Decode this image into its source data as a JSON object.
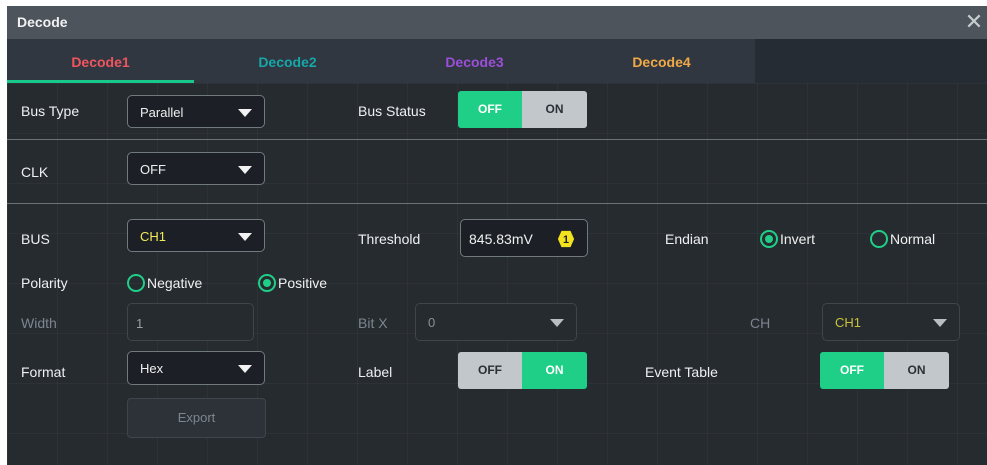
{
  "window": {
    "title": "Decode",
    "close_symbol": "✕"
  },
  "tabs": [
    {
      "label": "Decode1",
      "color": "#f0555f",
      "active": true
    },
    {
      "label": "Decode2",
      "color": "#16a7a9",
      "active": false
    },
    {
      "label": "Decode3",
      "color": "#9b4fd8",
      "active": false
    },
    {
      "label": "Decode4",
      "color": "#f0a946",
      "active": false
    }
  ],
  "bus_type": {
    "label": "Bus Type",
    "value": "Parallel"
  },
  "bus_status": {
    "label": "Bus Status",
    "off_label": "OFF",
    "on_label": "ON",
    "state": "OFF"
  },
  "clk": {
    "label": "CLK",
    "value": "OFF"
  },
  "bus": {
    "label": "BUS",
    "value": "CH1",
    "value_color": "#f2ea57"
  },
  "threshold": {
    "label": "Threshold",
    "value": "845.83mV",
    "badge": "1",
    "badge_color": "#f2e21d"
  },
  "endian": {
    "label": "Endian",
    "options": [
      "Invert",
      "Normal"
    ],
    "selected": "Invert"
  },
  "polarity": {
    "label": "Polarity",
    "options": [
      "Negative",
      "Positive"
    ],
    "selected": "Positive"
  },
  "width": {
    "label": "Width",
    "value": "1"
  },
  "bit_x": {
    "label": "Bit X",
    "value": "0"
  },
  "ch": {
    "label": "CH",
    "value": "CH1",
    "value_color": "#c9c23a"
  },
  "format": {
    "label": "Format",
    "value": "Hex"
  },
  "label_toggle": {
    "label": "Label",
    "off_label": "OFF",
    "on_label": "ON",
    "state": "ON"
  },
  "event_table": {
    "label": "Event Table",
    "off_label": "OFF",
    "on_label": "ON",
    "state": "OFF"
  },
  "export": {
    "label": "Export"
  },
  "colors": {
    "accent": "#1fcf87",
    "panel_bg": "#262b30",
    "titlebar_bg": "#4d545c"
  }
}
